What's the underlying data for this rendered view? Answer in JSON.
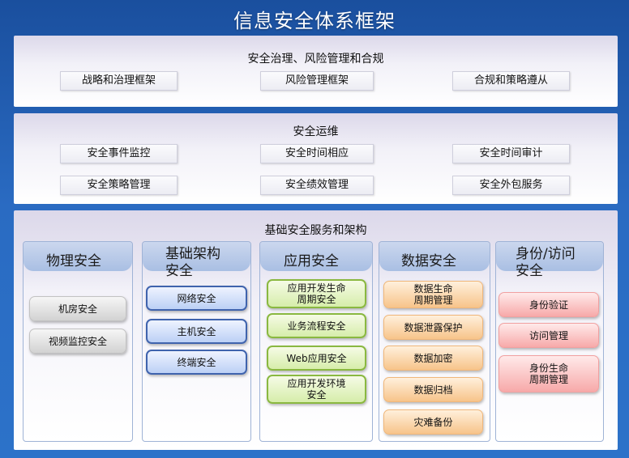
{
  "title": "信息安全体系框架",
  "governance": {
    "title": "安全治理、风险管理和合规",
    "items": [
      "战略和治理框架",
      "风险管理框架",
      "合规和策略遵从"
    ]
  },
  "operations": {
    "title": "安全运维",
    "items": [
      "安全事件监控",
      "安全时间相应",
      "安全时间审计",
      "安全策略管理",
      "安全绩效管理",
      "安全外包服务"
    ]
  },
  "infrastructure": {
    "title": "基础安全服务和架构",
    "columns": [
      {
        "header": [
          "物理安全"
        ],
        "items": [
          "机房安全",
          "视频监控安全"
        ]
      },
      {
        "header": [
          "基础架构",
          "安全"
        ],
        "items": [
          "网络安全",
          "主机安全",
          "终端安全"
        ]
      },
      {
        "header": [
          "应用安全"
        ],
        "items": [
          [
            "应用开发生命",
            "周期安全"
          ],
          [
            "业务流程安全"
          ],
          [
            "Web应用安全"
          ],
          [
            "应用开发环境",
            "安全"
          ]
        ]
      },
      {
        "header": [
          "数据安全"
        ],
        "items": [
          [
            "数据生命",
            "周期管理"
          ],
          [
            "数据泄露保护"
          ],
          [
            "数据加密"
          ],
          [
            "数据归档"
          ],
          [
            "灾难备份"
          ]
        ]
      },
      {
        "header": [
          "身份/访问",
          "安全"
        ],
        "items": [
          [
            "身份验证"
          ],
          [
            "访问管理"
          ],
          [
            "身份生命",
            "周期管理"
          ]
        ]
      }
    ]
  }
}
